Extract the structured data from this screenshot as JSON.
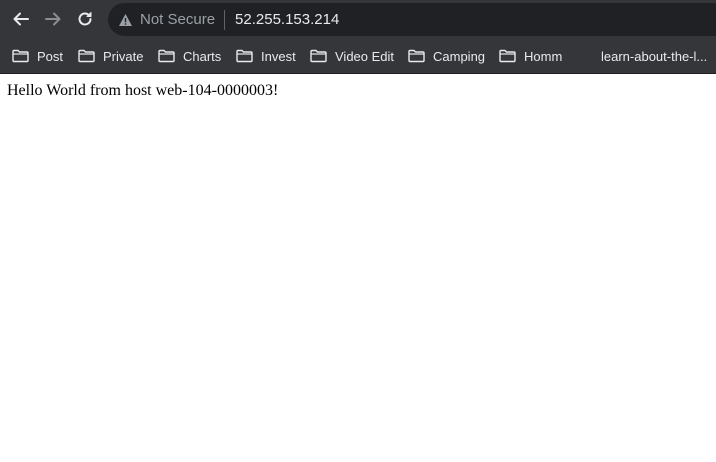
{
  "browser": {
    "security_label": "Not Secure",
    "url": "52.255.153.214",
    "nav": {
      "back_icon": "arrow-left-icon",
      "forward_icon": "arrow-right-icon",
      "reload_icon": "reload-icon",
      "security_icon": "warning-triangle-icon"
    },
    "bookmarks": [
      {
        "label": "Post",
        "icon": "folder-icon"
      },
      {
        "label": "Private",
        "icon": "folder-icon"
      },
      {
        "label": "Charts",
        "icon": "folder-icon"
      },
      {
        "label": "Invest",
        "icon": "folder-icon"
      },
      {
        "label": "Video Edit",
        "icon": "folder-icon"
      },
      {
        "label": "Camping",
        "icon": "folder-icon"
      },
      {
        "label": "Homm",
        "icon": "folder-icon"
      },
      {
        "label": "learn-about-the-l...",
        "icon": "favicon"
      }
    ],
    "colors": {
      "chrome_bg": "#35363a",
      "omnibox_bg": "#202124",
      "text": "#e8eaed",
      "muted": "#9aa0a6"
    }
  },
  "page": {
    "body_text": "Hello World from host web-104-0000003!"
  }
}
